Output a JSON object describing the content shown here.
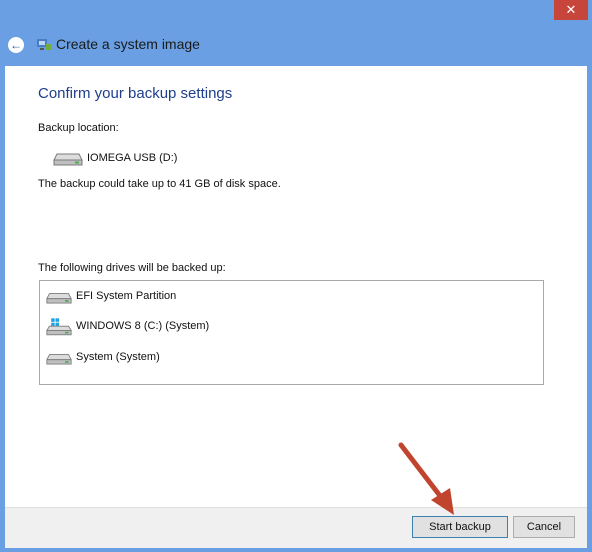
{
  "window": {
    "title": "Create a system image",
    "close_glyph": "✕",
    "back_glyph": "←"
  },
  "main": {
    "heading": "Confirm your backup settings",
    "backup_location_label": "Backup location:",
    "backup_location": {
      "name": "IOMEGA USB (D:)",
      "icon": "hard-drive-icon"
    },
    "space_notice": "The backup could take up to 41 GB of disk space.",
    "drives_label": "The following drives will be backed up:",
    "drives": [
      {
        "name": "EFI System Partition",
        "icon": "hard-drive-icon"
      },
      {
        "name": "WINDOWS 8 (C:) (System)",
        "icon": "windows-drive-icon"
      },
      {
        "name": "System (System)",
        "icon": "hard-drive-icon"
      }
    ]
  },
  "footer": {
    "start_label": "Start backup",
    "cancel_label": "Cancel"
  },
  "colors": {
    "frame": "#6aa0e3",
    "heading": "#1e3e8c",
    "close": "#c7453a",
    "arrow": "#c0442e"
  }
}
